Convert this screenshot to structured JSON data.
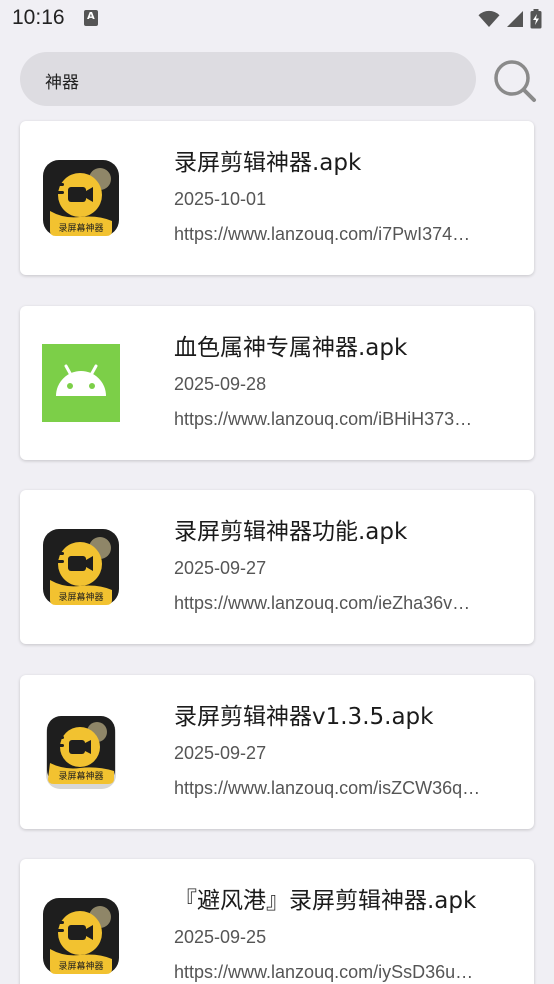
{
  "status_bar": {
    "time": "10:16",
    "icons": [
      "app-notification-icon",
      "wifi-icon",
      "cellular-signal-icon",
      "battery-charging-icon"
    ]
  },
  "search": {
    "query": "神器",
    "button_icon": "search-icon"
  },
  "results": [
    {
      "title": "录屏剪辑神器.apk",
      "date": "2025-10-01",
      "url": "https://www.lanzouq.com/i7PwI374…",
      "icon": "screen-recorder-app-icon",
      "icon_label": "录屏幕神器"
    },
    {
      "title": "血色属神专属神器.apk",
      "date": "2025-09-28",
      "url": "https://www.lanzouq.com/iBHiH373…",
      "icon": "android-app-icon",
      "icon_label": ""
    },
    {
      "title": "录屏剪辑神器功能.apk",
      "date": "2025-09-27",
      "url": "https://www.lanzouq.com/ieZha36v…",
      "icon": "screen-recorder-app-icon",
      "icon_label": "录屏幕神器"
    },
    {
      "title": "录屏剪辑神器v1.3.5.apk",
      "date": "2025-09-27",
      "url": "https://www.lanzouq.com/isZCW36q…",
      "icon": "screen-recorder-app-icon",
      "icon_label": "录屏幕神器"
    },
    {
      "title": "『避风港』录屏剪辑神器.apk",
      "date": "2025-09-25",
      "url": "https://www.lanzouq.com/iySsD36u…",
      "icon": "screen-recorder-app-icon",
      "icon_label": "录屏幕神器"
    }
  ],
  "colors": {
    "background": "#f0eff4",
    "search_bg": "#dddce1",
    "card_bg": "#ffffff",
    "recorder_icon_bg": "#1e1e1e",
    "recorder_icon_yellow": "#f2c230",
    "android_green": "#7ccf48"
  }
}
